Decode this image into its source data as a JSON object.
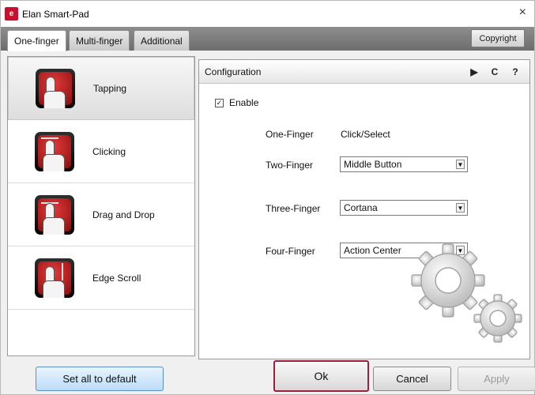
{
  "window": {
    "title": "Elan Smart-Pad",
    "close_glyph": "×"
  },
  "tabs": [
    {
      "label": "One-finger",
      "active": true
    },
    {
      "label": "Multi-finger",
      "active": false
    },
    {
      "label": "Additional",
      "active": false
    }
  ],
  "copyright_label": "Copyright",
  "features": [
    {
      "label": "Tapping",
      "selected": true,
      "icon": "tap-gesture-icon"
    },
    {
      "label": "Clicking",
      "selected": false,
      "icon": "click-gesture-icon"
    },
    {
      "label": "Drag and Drop",
      "selected": false,
      "icon": "drag-gesture-icon"
    },
    {
      "label": "Edge Scroll",
      "selected": false,
      "icon": "edge-scroll-icon"
    }
  ],
  "config": {
    "title": "Configuration",
    "header_icons": [
      "play-icon",
      "refresh-icon",
      "help-icon"
    ],
    "play_glyph": "▶",
    "refresh_glyph": "C",
    "help_glyph": "?",
    "enable_label": "Enable",
    "enable_checked": true,
    "rows": [
      {
        "label": "One-Finger",
        "value": "Click/Select",
        "type": "text"
      },
      {
        "label": "Two-Finger",
        "value": "Middle Button",
        "type": "dropdown"
      },
      {
        "label": "Three-Finger",
        "value": "Cortana",
        "type": "dropdown"
      },
      {
        "label": "Four-Finger",
        "value": "Action Center",
        "type": "dropdown"
      }
    ]
  },
  "buttons": {
    "set_default": "Set all to default",
    "ok": "Ok",
    "cancel": "Cancel",
    "apply": "Apply"
  },
  "colors": {
    "accent_red": "#c8102e",
    "ok_highlight": "#9c1f3f",
    "default_button": "#bcdcf8"
  }
}
